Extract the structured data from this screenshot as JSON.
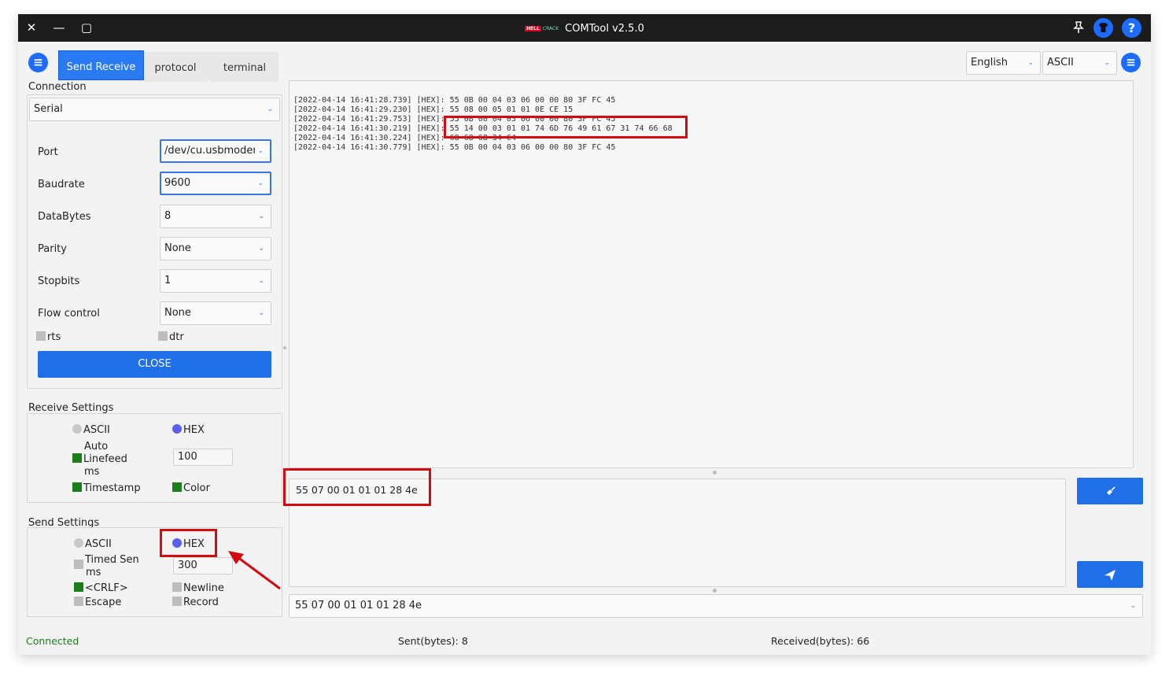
{
  "window": {
    "title": "COMTool v2.5.0",
    "logo_left": "HELL",
    "logo_right": "CRACK"
  },
  "titlebar": {
    "close_glyph": "✕",
    "min_glyph": "—",
    "max_glyph": "▢"
  },
  "tabs": [
    "Send Receive",
    "protocol",
    "terminal"
  ],
  "language": {
    "selected": "English"
  },
  "encoding": {
    "selected": "ASCII"
  },
  "connection": {
    "title": "Connection",
    "type": "Serial",
    "fields": [
      {
        "label": "Port",
        "value": "/dev/cu.usbmodem"
      },
      {
        "label": "Baudrate",
        "value": "9600"
      },
      {
        "label": "DataBytes",
        "value": "8"
      },
      {
        "label": "Parity",
        "value": "None"
      },
      {
        "label": "Stopbits",
        "value": "1"
      },
      {
        "label": "Flow control",
        "value": "None"
      }
    ],
    "rts": "rts",
    "dtr": "dtr",
    "close_button": "CLOSE"
  },
  "receive_settings": {
    "title": "Receive Settings",
    "ascii": "ASCII",
    "hex": "HEX",
    "auto": "Auto",
    "linefeed": "Linefeed",
    "ms": "ms",
    "linefeed_value": "100",
    "timestamp": "Timestamp",
    "color": "Color"
  },
  "send_settings": {
    "title": "Send Settings",
    "ascii": "ASCII",
    "hex": "HEX",
    "timed_send": "Timed Sen",
    "ms": "ms",
    "timed_value": "300",
    "crlf": "<CRLF>",
    "newline": "Newline",
    "escape": "Escape",
    "record": "Record"
  },
  "receive_log": [
    "[2022-04-14 16:41:28.739] [HEX]: 55 0B 00 04 03 06 00 00 80 3F FC 45",
    "[2022-04-14 16:41:29.230] [HEX]: 55 08 00 05 01 01 0E CE 15",
    "[2022-04-14 16:41:29.753] [HEX]: 55 0B 00 04 03 06 00 00 80 3F FC 45",
    "[2022-04-14 16:41:30.219] [HEX]: 55 14 00 03 01 01 74 6D 76 49 61 67 31 74 66 68",
    "[2022-04-14 16:41:30.224] [HEX]: 68 68 68 34 C4",
    "[2022-04-14 16:41:30.779] [HEX]: 55 0B 00 04 03 06 00 00 80 3F FC 45"
  ],
  "send_input": "55 07 00 01 01 01 28 4e",
  "history": {
    "selected": "55 07 00 01 01 01 28 4e"
  },
  "status": {
    "connection": "Connected",
    "sent": "Sent(bytes): 8",
    "received": "Received(bytes): 66"
  },
  "colors": {
    "accent": "#1e6fe8",
    "highlight": "#d20a12",
    "connected": "#1a7f1a"
  }
}
